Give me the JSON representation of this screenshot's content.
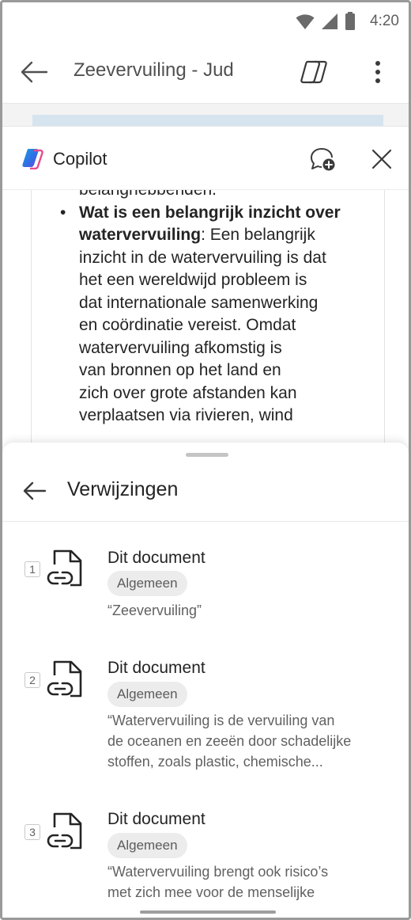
{
  "status_bar": {
    "time": "4:20"
  },
  "app_bar": {
    "document_title": "Zeevervuiling - Jud"
  },
  "copilot": {
    "title": "Copilot",
    "message": {
      "partial_line": "belanghebbenden.",
      "bullet_heading": "Wat is een belangrijk inzicht over watervervuiling",
      "bullet_heading_line1": "Wat is een belangrijk inzicht over",
      "bullet_heading_line2": "watervervuiling",
      "bullet_lines": [
        ": Een belangrijk",
        "inzicht in de watervervuiling is dat",
        "het een wereldwijd probleem is",
        "dat internationale samenwerking",
        "en coördinatie vereist. Omdat",
        "watervervuiling afkomstig is",
        "van bronnen op het land en",
        "zich over grote afstanden kan",
        "verplaatsen via rivieren, wind"
      ]
    }
  },
  "references": {
    "title": "Verwijzingen",
    "items": [
      {
        "number": "1",
        "title": "Dit document",
        "tag": "Algemeen",
        "quote_lines": [
          "“Zeevervuiling”"
        ]
      },
      {
        "number": "2",
        "title": "Dit document",
        "tag": "Algemeen",
        "quote_lines": [
          "“Watervervuiling is de vervuiling van",
          "de oceanen en zeeën door schadelijke",
          "stoffen, zoals plastic, chemische..."
        ]
      },
      {
        "number": "3",
        "title": "Dit document",
        "tag": "Algemeen",
        "quote_lines": [
          "“Watervervuiling brengt ook risico’s",
          "met zich mee voor de menselijke"
        ]
      }
    ]
  },
  "colors": {
    "text_primary": "#242424",
    "text_secondary": "#616161",
    "tag_bg": "#ececec",
    "copilot_blue": "#1b9de2",
    "copilot_purple": "#6b47dc"
  }
}
